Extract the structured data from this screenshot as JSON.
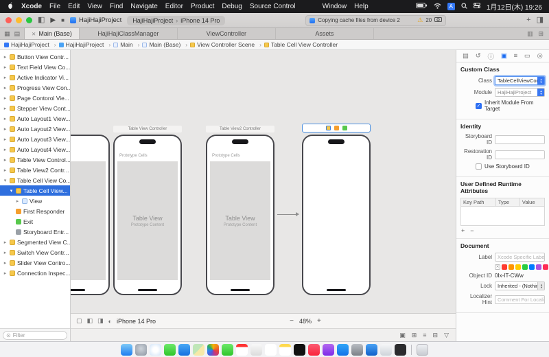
{
  "menubar": {
    "items": [
      "Xcode",
      "File",
      "Edit",
      "View",
      "Find",
      "Navigate",
      "Editor",
      "Product",
      "Debug",
      "Source Control"
    ],
    "right_menus": [
      "Window",
      "Help"
    ],
    "input_badge": "A",
    "clock": "1月12日(木) 19:26"
  },
  "toolbar": {
    "scheme_name": "HajiHajiProject",
    "destination_app": "HajiHajiProject",
    "destination_device": "iPhone 14 Pro",
    "status_text": "Copying cache files from device 2",
    "warning_count": "20",
    "plus_label": "+"
  },
  "tabbar": {
    "close_glyph": "✕",
    "active_tab": "Main (Base)",
    "tabs": [
      "HajiHajiClassManager",
      "ViewController",
      "Assets"
    ]
  },
  "breadcrumb": {
    "items": [
      "HajiHajiProject",
      "HajiHajiProject",
      "Main",
      "Main (Base)",
      "View Controller Scene",
      "Table Cell View Controller"
    ]
  },
  "navigator": {
    "filter_placeholder": "Filter",
    "items": [
      {
        "label": "Button View Contr...",
        "level": 0,
        "icon": "view-controller"
      },
      {
        "label": "Text Field View Co...",
        "level": 0,
        "icon": "view-controller"
      },
      {
        "label": "Active Indicator Vi...",
        "level": 0,
        "icon": "view-controller"
      },
      {
        "label": "Progress View Con...",
        "level": 0,
        "icon": "view-controller"
      },
      {
        "label": "Page Contorol Vie...",
        "level": 0,
        "icon": "view-controller"
      },
      {
        "label": "Stepper View Cont...",
        "level": 0,
        "icon": "view-controller"
      },
      {
        "label": "Auto Layout1 View...",
        "level": 0,
        "icon": "view-controller"
      },
      {
        "label": "Auto Layout2 View...",
        "level": 0,
        "icon": "view-controller"
      },
      {
        "label": "Auto Layout3 View...",
        "level": 0,
        "icon": "view-controller"
      },
      {
        "label": "Auto Layout4 View...",
        "level": 0,
        "icon": "view-controller"
      },
      {
        "label": "Table View Control...",
        "level": 0,
        "icon": "view-controller"
      },
      {
        "label": "Table View2 Contr...",
        "level": 0,
        "icon": "view-controller"
      },
      {
        "label": "Table Cell View Co...",
        "level": 0,
        "icon": "view-controller",
        "expanded": true
      },
      {
        "label": "Table Cell View...",
        "level": 1,
        "icon": "view-controller",
        "expanded": true,
        "selected": true
      },
      {
        "label": "View",
        "level": 2,
        "icon": "view"
      },
      {
        "label": "First Responder",
        "level": 1,
        "icon": "first-responder"
      },
      {
        "label": "Exit",
        "level": 1,
        "icon": "exit"
      },
      {
        "label": "Storyboard Entr...",
        "level": 1,
        "icon": "storyboard-entry"
      },
      {
        "label": "Segmented View C...",
        "level": 0,
        "icon": "view-controller"
      },
      {
        "label": "Switch View Contr...",
        "level": 0,
        "icon": "view-controller"
      },
      {
        "label": "Slider View Contro...",
        "level": 0,
        "icon": "view-controller"
      },
      {
        "label": "Connection Inspec...",
        "level": 0,
        "icon": "view-controller"
      }
    ]
  },
  "canvas": {
    "scenes": [
      {
        "title": "Table View Controller",
        "prototype_label": "Prototype Cells",
        "table_title": "Table View",
        "table_subtitle": "Prototype Content"
      },
      {
        "title": "Table View2 Controller",
        "prototype_label": "Prototype Cells",
        "table_title": "Table View",
        "table_subtitle": "Prototype Content"
      },
      {
        "title": "",
        "selected": true
      }
    ],
    "bottombar": {
      "device": "iPhone 14 Pro",
      "zoom_out": "−",
      "zoom_level": "48%",
      "zoom_in": "+"
    }
  },
  "inspector": {
    "custom_class": {
      "header": "Custom Class",
      "class_label": "Class",
      "class_value": "TableCellViewController",
      "module_label": "Module",
      "module_value": "HajiHajiProject",
      "inherit_label": "Inherit Module From Target"
    },
    "identity": {
      "header": "Identity",
      "storyboard_id_label": "Storyboard ID",
      "restoration_id_label": "Restoration ID",
      "use_storyboard_label": "Use Storyboard ID"
    },
    "runtime_attributes": {
      "header": "User Defined Runtime Attributes",
      "columns": [
        "Key Path",
        "Type",
        "Value"
      ],
      "add": "+",
      "remove": "−"
    },
    "document": {
      "header": "Document",
      "label_label": "Label",
      "label_placeholder": "Xcode Specific Label",
      "clear_glyph": "✕",
      "swatches": [
        "#ff3b30",
        "#ff9500",
        "#ffcc00",
        "#28cd41",
        "#007aff",
        "#af52de",
        "#ff2d55"
      ],
      "object_id_label": "Object ID",
      "object_id": "0Ix-IT-CWw",
      "lock_label": "Lock",
      "lock_value": "Inherited - (Nothing)",
      "localizer_label": "Localizer Hint",
      "localizer_placeholder": "Comment For Localizer"
    }
  },
  "dock": {
    "apps": [
      "Finder",
      "Launchpad",
      "Safari",
      "Messages",
      "Mail",
      "Maps",
      "Photos",
      "FaceTime",
      "Calendar",
      "Contacts",
      "Reminders",
      "Notes",
      "TV",
      "Music",
      "Podcasts",
      "App Store",
      "System Settings",
      "Xcode",
      "Simulator",
      "Terminal",
      "Trash"
    ]
  }
}
